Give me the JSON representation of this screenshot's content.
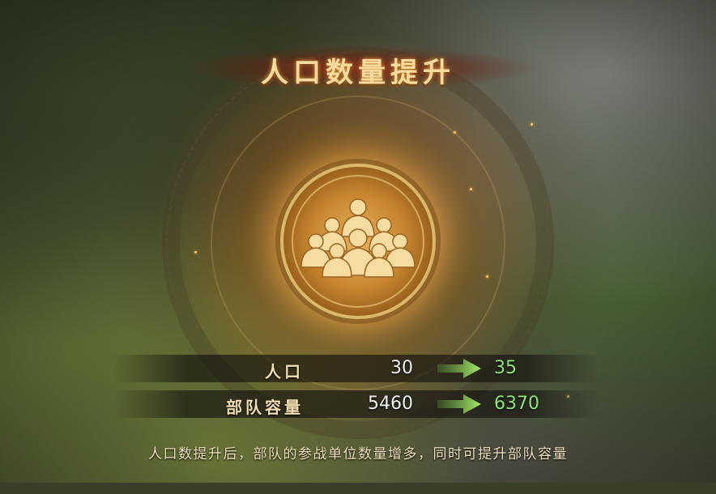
{
  "popup": {
    "title": "人口数量提升",
    "emblem_icon": "soldier-group-icon",
    "stats": [
      {
        "label": "人口",
        "old_value": "30",
        "new_value": "35"
      },
      {
        "label": "部队容量",
        "old_value": "5460",
        "new_value": "6370"
      }
    ],
    "description": "人口数提升后，部队的参战单位数量增多，同时可提升部队容量"
  },
  "colors": {
    "title": "#f5dc9e",
    "new_value": "#8fe37a",
    "arrow": "#7fd14f",
    "emblem": "#c8852e"
  }
}
